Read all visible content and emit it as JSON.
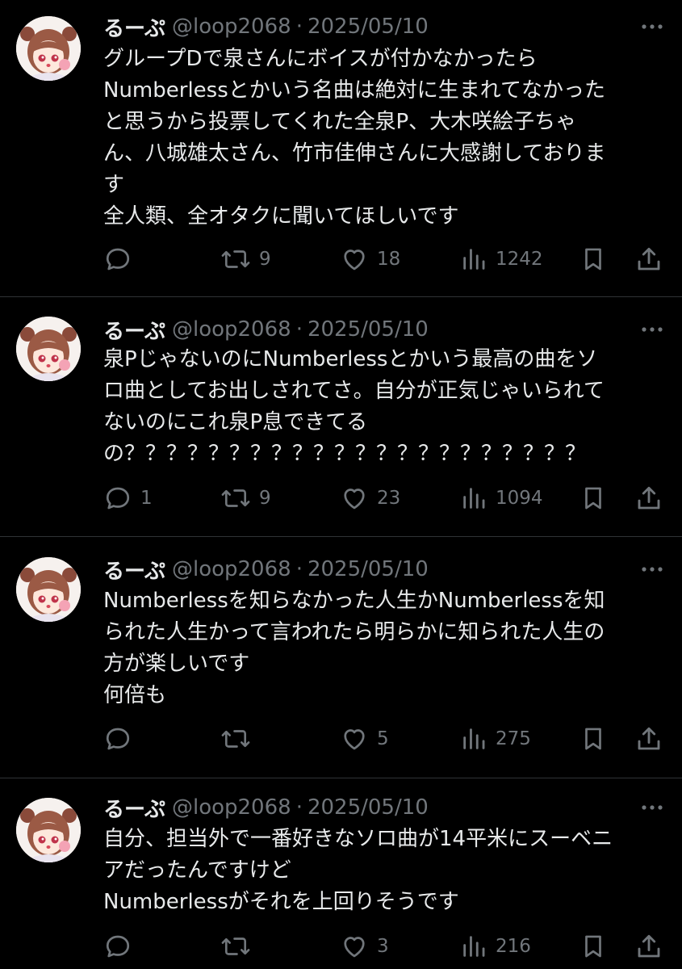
{
  "tweets": [
    {
      "name": "るーぷ",
      "handle": "@loop2068",
      "separator": "·",
      "date": "2025/05/10",
      "text": "グループDで泉さんにボイスが付かなかったら\nNumberlessとかいう名曲は絶対に生まれてなかった\nと思うから投票してくれた全泉P、大木咲絵子ちゃ\nん、八城雄太さん、竹市佳伸さんに大感謝しておりま\nす\n全人類、全オタクに聞いてほしいです",
      "replies": "",
      "reposts": "9",
      "likes": "18",
      "views": "1242"
    },
    {
      "name": "るーぷ",
      "handle": "@loop2068",
      "separator": "·",
      "date": "2025/05/10",
      "text": "泉PじゃないのにNumberlessとかいう最高の曲をソ\nロ曲としてお出しされてさ。自分が正気じゃいられて\nないのにこれ泉P息できてる\nの？？？？？？？？？？？？？？？？？？？？？？",
      "replies": "1",
      "reposts": "9",
      "likes": "23",
      "views": "1094"
    },
    {
      "name": "るーぷ",
      "handle": "@loop2068",
      "separator": "·",
      "date": "2025/05/10",
      "text": "Numberlessを知らなかった人生かNumberlessを知\nられた人生かって言われたら明らかに知られた人生の\n方が楽しいです\n何倍も",
      "replies": "",
      "reposts": "",
      "likes": "5",
      "views": "275"
    },
    {
      "name": "るーぷ",
      "handle": "@loop2068",
      "separator": "·",
      "date": "2025/05/10",
      "text": "自分、担当外で一番好きなソロ曲が14平米にスーベニ\nアだったんですけど\nNumberlessがそれを上回りそうです",
      "replies": "",
      "reposts": "",
      "likes": "3",
      "views": "216"
    }
  ],
  "icons": {
    "avatar": "avatar-icon",
    "more": "more-icon",
    "reply": "reply-icon",
    "repost": "repost-icon",
    "like": "like-icon",
    "views": "views-icon",
    "bookmark": "bookmark-icon",
    "share": "share-icon"
  },
  "colors": {
    "background": "#000000",
    "text": "#e7e9ea",
    "secondary": "#71767b",
    "divider": "#2f3336"
  }
}
